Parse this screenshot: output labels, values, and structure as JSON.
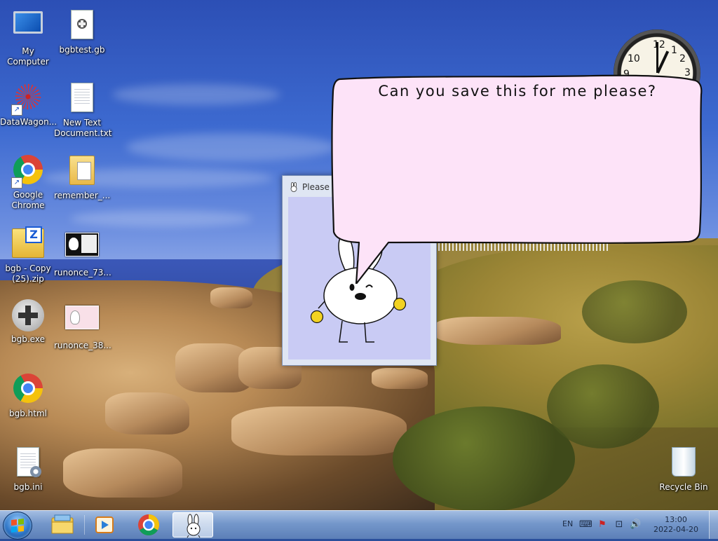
{
  "desktop": {
    "icons_left": [
      {
        "label": "My Computer"
      },
      {
        "label": "bgbtest.gb"
      },
      {
        "label": "DataWagon..."
      },
      {
        "label": "New Text Document.txt"
      },
      {
        "label": "Google Chrome"
      },
      {
        "label": "remember_..."
      },
      {
        "label": "bgb - Copy (25).zip"
      },
      {
        "label": "runonce_73..."
      },
      {
        "label": "bgb.exe"
      },
      {
        "label": "runonce_38..."
      },
      {
        "label": "bgb.html"
      },
      {
        "label": "bgb.ini"
      }
    ],
    "recycle_bin": {
      "label": "Recycle Bin"
    }
  },
  "clock_gadget": {
    "numerals": [
      "12",
      "1",
      "2",
      "3",
      "10",
      "9"
    ]
  },
  "dialog": {
    "title": "Please s"
  },
  "speech_bubble": {
    "text": "Can you save this for me please?"
  },
  "taskbar": {
    "pinned": [
      {
        "icon": "start-orb-icon"
      },
      {
        "icon": "file-explorer-icon"
      },
      {
        "icon": "media-player-icon"
      },
      {
        "icon": "chrome-icon"
      },
      {
        "icon": "bunny-app-icon"
      }
    ],
    "tray": {
      "language": "EN",
      "time": "13:00",
      "date": "2022-04-20"
    }
  }
}
